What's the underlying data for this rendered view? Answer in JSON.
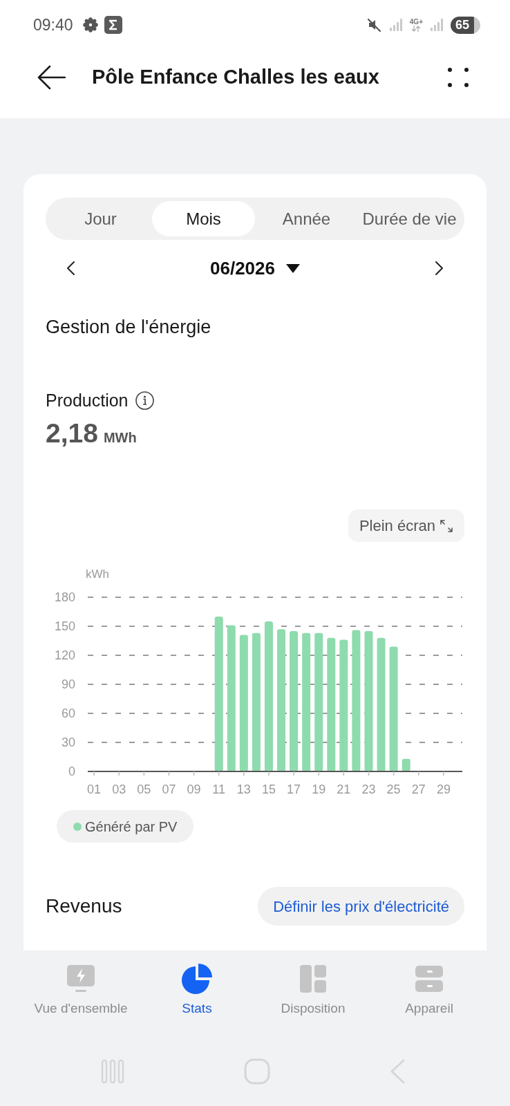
{
  "status_bar": {
    "time": "09:40",
    "network": "4G+",
    "battery": "65"
  },
  "header": {
    "title": "Pôle Enfance Challes les eaux"
  },
  "period_tabs": [
    {
      "label": "Jour",
      "selected": false
    },
    {
      "label": "Mois",
      "selected": true
    },
    {
      "label": "Année",
      "selected": false
    },
    {
      "label": "Durée de vie",
      "selected": false
    }
  ],
  "date_picker": {
    "value": "06/2026"
  },
  "energy": {
    "title": "Gestion de l'énergie",
    "production_label": "Production",
    "production_value": "2,18",
    "production_unit": "MWh",
    "fullscreen_button": "Plein écran",
    "chart_data": {
      "type": "bar",
      "ylabel": "kWh",
      "x": [
        11,
        12,
        13,
        14,
        15,
        16,
        17,
        18,
        19,
        20,
        21,
        22,
        23,
        24,
        25,
        26
      ],
      "series": [
        {
          "name": "Généré par PV",
          "color": "#8edbad",
          "values": [
            160,
            151,
            141,
            143,
            155,
            147,
            145,
            143,
            143,
            138,
            136,
            146,
            145,
            138,
            129,
            13
          ]
        }
      ],
      "xlim": [
        0.5,
        30.5
      ],
      "ylim": [
        0,
        180
      ],
      "grid": true,
      "yticks": [
        0,
        30,
        60,
        90,
        120,
        150,
        180
      ],
      "xticks": [
        {
          "value": 1,
          "label": "01"
        },
        {
          "value": 3,
          "label": "03"
        },
        {
          "value": 5,
          "label": "05"
        },
        {
          "value": 7,
          "label": "07"
        },
        {
          "value": 9,
          "label": "09"
        },
        {
          "value": 11,
          "label": "11"
        },
        {
          "value": 13,
          "label": "13"
        },
        {
          "value": 15,
          "label": "15"
        },
        {
          "value": 17,
          "label": "17"
        },
        {
          "value": 19,
          "label": "19"
        },
        {
          "value": 21,
          "label": "21"
        },
        {
          "value": 23,
          "label": "23"
        },
        {
          "value": 25,
          "label": "25"
        },
        {
          "value": 27,
          "label": "27"
        },
        {
          "value": 29,
          "label": "29"
        }
      ]
    }
  },
  "revenue": {
    "title": "Revenus",
    "button": "Définir les prix d'électricité"
  },
  "bottom_nav": [
    {
      "label": "Vue d'ensemble",
      "selected": false
    },
    {
      "label": "Stats",
      "selected": true
    },
    {
      "label": "Disposition",
      "selected": false
    },
    {
      "label": "Appareil",
      "selected": false
    }
  ]
}
